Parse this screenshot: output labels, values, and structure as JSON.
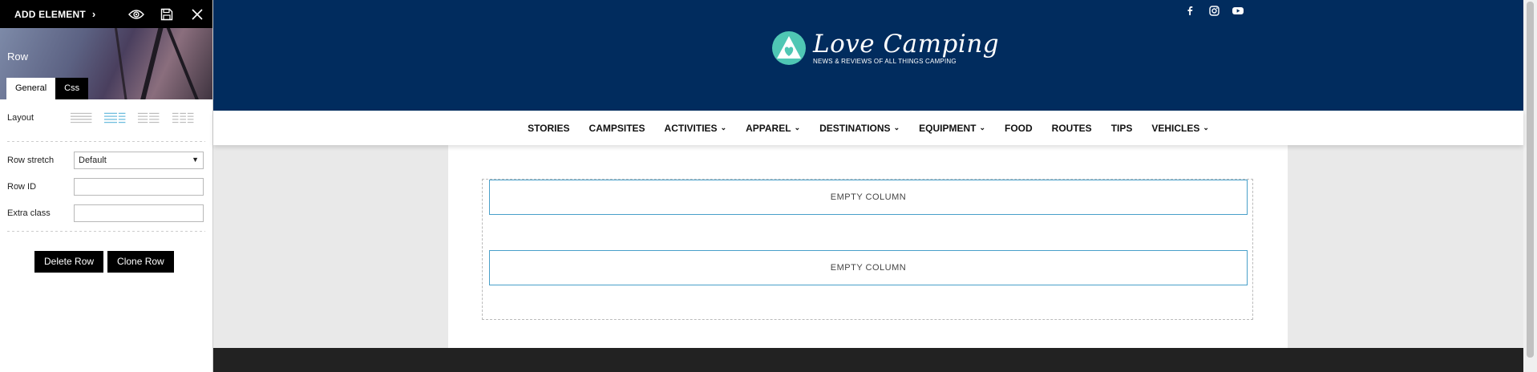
{
  "editor": {
    "add_element": "ADD ELEMENT",
    "panel_title": "Row",
    "tabs": [
      "General",
      "Css"
    ],
    "layout_label": "Layout",
    "row_stretch_label": "Row stretch",
    "row_stretch_value": "Default",
    "row_id_label": "Row ID",
    "extra_class_label": "Extra class",
    "delete_button": "Delete Row",
    "clone_button": "Clone Row",
    "icons": [
      "eye-icon",
      "save-icon",
      "close-icon"
    ]
  },
  "site": {
    "social_icons": [
      "facebook-icon",
      "instagram-icon",
      "youtube-icon"
    ],
    "logo_name": "Love Camping",
    "logo_tagline": "NEWS & REVIEWS OF ALL THINGS CAMPING",
    "nav": [
      {
        "label": "STORIES",
        "dropdown": false
      },
      {
        "label": "CAMPSITES",
        "dropdown": false
      },
      {
        "label": "ACTIVITIES",
        "dropdown": true
      },
      {
        "label": "APPAREL",
        "dropdown": true
      },
      {
        "label": "DESTINATIONS",
        "dropdown": true
      },
      {
        "label": "EQUIPMENT",
        "dropdown": true
      },
      {
        "label": "FOOD",
        "dropdown": false
      },
      {
        "label": "ROUTES",
        "dropdown": false
      },
      {
        "label": "TIPS",
        "dropdown": false
      },
      {
        "label": "VEHICLES",
        "dropdown": true
      }
    ],
    "columns": [
      "EMPTY COLUMN",
      "EMPTY COLUMN"
    ]
  },
  "colors": {
    "header_bg": "#012c5e",
    "logo_accent": "#4fc7b4",
    "column_border": "#49a0c9",
    "layout_active": "#5bb5d9",
    "footer_bg": "#222222"
  }
}
